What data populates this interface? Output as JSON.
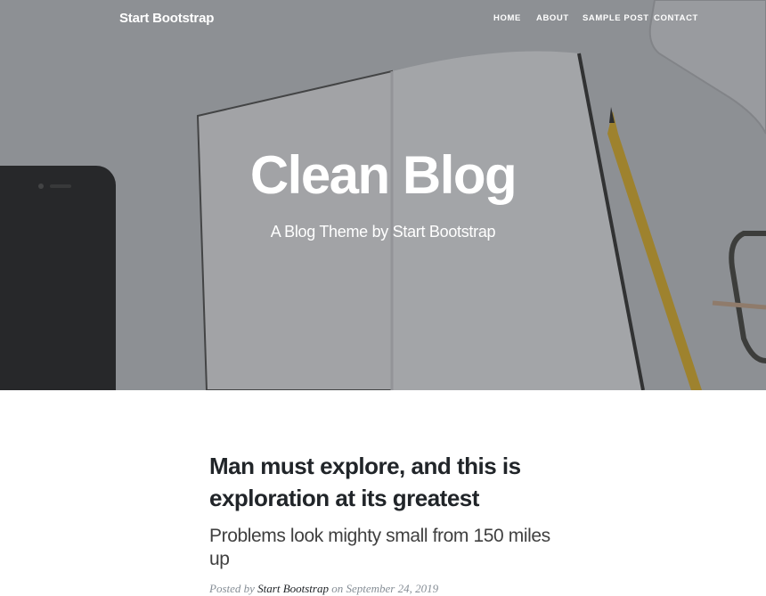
{
  "navbar": {
    "brand": "Start Bootstrap",
    "links": [
      "Home",
      "About",
      "Sample Post",
      "Contact"
    ]
  },
  "hero": {
    "title": "Clean Blog",
    "subtitle": "A Blog Theme by Start Bootstrap"
  },
  "post": {
    "title_line1": "Man must explore, and this is",
    "title_line2": "exploration at its greatest",
    "subtitle": "Problems look mighty small from 150 miles up",
    "meta_prefix": "Posted by",
    "author": "Start Bootstrap",
    "meta_on": "on September 24, 2019"
  },
  "colors": {
    "text_dark": "#212529",
    "text_muted": "#868e96",
    "hero_overlay": "#212529"
  }
}
